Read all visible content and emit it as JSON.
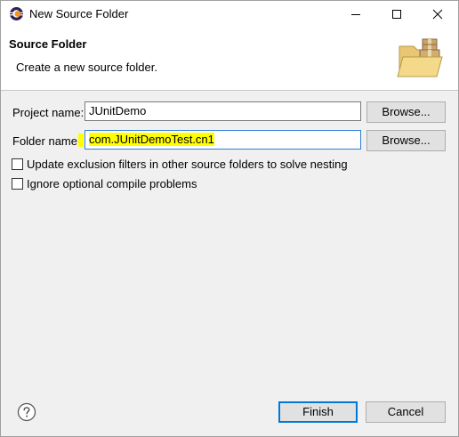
{
  "window": {
    "title": "New Source Folder",
    "icons": {
      "app": "eclipse-icon",
      "minimize": "minimize-icon",
      "maximize": "maximize-icon",
      "close": "close-icon"
    }
  },
  "banner": {
    "title": "Source Folder",
    "description": "Create a new source folder.",
    "icon": "folder-package-icon"
  },
  "form": {
    "project_label": "Project name:",
    "project_value": "JUnitDemo",
    "project_browse": "Browse...",
    "folder_label": "Folder name:",
    "folder_value": "com.JUnitDemoTest.cn1",
    "folder_browse": "Browse...",
    "option1": {
      "label": "Update exclusion filters in other source folders to solve nesting",
      "checked": false
    },
    "option2": {
      "label": "Ignore optional compile problems",
      "checked": false
    }
  },
  "footer": {
    "help_icon": "help-icon",
    "finish": "Finish",
    "cancel": "Cancel"
  },
  "colors": {
    "highlight": "#ffff00",
    "focus_border": "#2f7ed7",
    "default_button": "#0078d7"
  }
}
